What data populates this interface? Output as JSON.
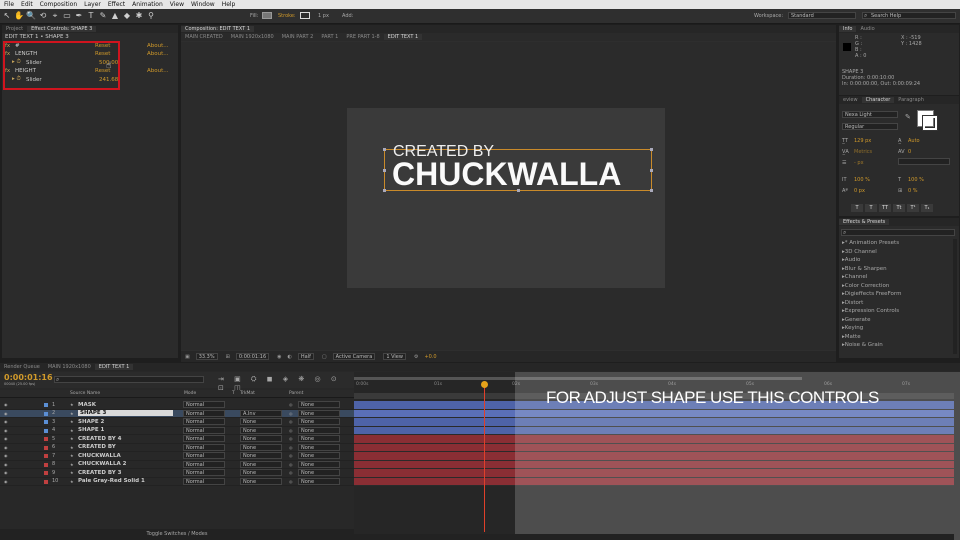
{
  "menubar": [
    "File",
    "Edit",
    "Composition",
    "Layer",
    "Effect",
    "Animation",
    "View",
    "Window",
    "Help"
  ],
  "toolbar": {
    "tools": [
      "↖",
      "✋",
      "🔍",
      "⟲",
      "⌖",
      "▭",
      "✒",
      "T",
      "✎",
      "▲",
      "◆",
      "✱",
      "⚲"
    ],
    "fill_label": "Fill:",
    "stroke_label": "Stroke:",
    "stroke_width": "1 px",
    "add_label": "Add:",
    "workspace_label": "Workspace:",
    "workspace_value": "Standard",
    "search_placeholder": "Search Help"
  },
  "project_panel": {
    "tabs": [
      "Project",
      "Effect Controls: SHAPE 3"
    ],
    "breadcrumb": "EDIT TEXT 1 • SHAPE 3",
    "rows": [
      {
        "name": "#",
        "reset": "Reset",
        "about": "About..."
      },
      {
        "name": "LENGTH",
        "reset": "Reset",
        "about": "About..."
      },
      {
        "name": "Slider",
        "value": "500.00"
      },
      {
        "name": "HEIGHT",
        "reset": "Reset",
        "about": "About..."
      },
      {
        "name": "Slider",
        "value": "241.68"
      }
    ]
  },
  "comp_panel": {
    "tab_label": "Composition: EDIT TEXT 1",
    "sub_tabs": [
      "MAIN CREATED",
      "MAIN 1920x1080",
      "MAIN PART 2",
      "PART 1",
      "PRE PART 1-8",
      "EDIT TEXT 1"
    ],
    "line1": "CREATED BY",
    "line2": "CHUCKWALLA",
    "footer": {
      "zoom": "33.3%",
      "timecode": "0:00:01:16",
      "res": "Half",
      "camera": "Active Camera",
      "view": "1 View",
      "offset": "+0.0"
    }
  },
  "info_panel": {
    "tabs": [
      "Info",
      "Audio"
    ],
    "rgb": [
      "R :",
      "G :",
      "B :",
      "A : 0"
    ],
    "coords": [
      "X : -519",
      "Y : 1428"
    ],
    "layer": "SHAPE 3",
    "duration": "Duration: 0:00:10:00",
    "inout": "In: 0:00:00:00, Out: 0:00:09:24"
  },
  "character_panel": {
    "tabs": [
      "eview",
      "Character",
      "Paragraph"
    ],
    "font": "Nexa Light",
    "style": "Regular",
    "size": "129 px",
    "leading": "Auto",
    "kerning": "Metrics",
    "tracking": "0",
    "indent": "- px",
    "vscale": "100 %",
    "hscale": "100 %",
    "baseline": "0 px",
    "tsume": "0 %",
    "format_buttons": [
      "T",
      "T",
      "TT",
      "Tt",
      "T¹",
      "T₁"
    ]
  },
  "effects_panel": {
    "title": "Effects & Presets",
    "search_placeholder": "",
    "items": [
      "* Animation Presets",
      "3D Channel",
      "Audio",
      "Blur & Sharpen",
      "Channel",
      "Color Correction",
      "Digieffects FreeForm",
      "Distort",
      "Expression Controls",
      "Generate",
      "Keying",
      "Matte",
      "Noise & Grain"
    ]
  },
  "timeline": {
    "tabs": [
      "Render Queue",
      "MAIN 1920x1080",
      "EDIT TEXT 1"
    ],
    "timecode": "0:00:01:16",
    "timecode_sub": "00040 (25.00 fps)",
    "search_placeholder": "",
    "col_headers": {
      "name": "Source Name",
      "mode": "Mode",
      "t": "T",
      "trkmat": "TrkMat",
      "parent": "Parent"
    },
    "ruler_labels": [
      "0:00s",
      "01s",
      "02s",
      "03s",
      "04s",
      "05s",
      "06s",
      "07s"
    ],
    "layers": [
      {
        "num": "1",
        "color": "#5b8fd5",
        "name": "MASK",
        "mode": "Normal",
        "trk": "",
        "parent": "None",
        "selected": false
      },
      {
        "num": "2",
        "color": "#5b8fd5",
        "name": "SHAPE 3",
        "mode": "Normal",
        "trk": "A.Inv",
        "parent": "None",
        "selected": true
      },
      {
        "num": "3",
        "color": "#5b8fd5",
        "name": "SHAPE 2",
        "mode": "Normal",
        "trk": "None",
        "parent": "None",
        "selected": false
      },
      {
        "num": "4",
        "color": "#5b8fd5",
        "name": "SHAPE 1",
        "mode": "Normal",
        "trk": "None",
        "parent": "None",
        "selected": false
      },
      {
        "num": "5",
        "color": "#c04040",
        "name": "CREATED BY 4",
        "mode": "Normal",
        "trk": "None",
        "parent": "None",
        "selected": false
      },
      {
        "num": "6",
        "color": "#c04040",
        "name": "CREATED BY",
        "mode": "Normal",
        "trk": "None",
        "parent": "None",
        "selected": false
      },
      {
        "num": "7",
        "color": "#c04040",
        "name": "CHUCKWALLA",
        "mode": "Normal",
        "trk": "None",
        "parent": "None",
        "selected": false
      },
      {
        "num": "8",
        "color": "#c04040",
        "name": "CHUCKWALLA 2",
        "mode": "Normal",
        "trk": "None",
        "parent": "None",
        "selected": false
      },
      {
        "num": "9",
        "color": "#c04040",
        "name": "CREATED BY 3",
        "mode": "Normal",
        "trk": "None",
        "parent": "None",
        "selected": false
      },
      {
        "num": "10",
        "color": "#c04040",
        "name": "Pale Gray-Red Solid 1",
        "mode": "Normal",
        "trk": "None",
        "parent": "None",
        "selected": false
      }
    ],
    "toggle_label": "Toggle Switches / Modes",
    "overlay_text": "FOR ADJUST SHAPE USE THIS CONTROLS"
  }
}
